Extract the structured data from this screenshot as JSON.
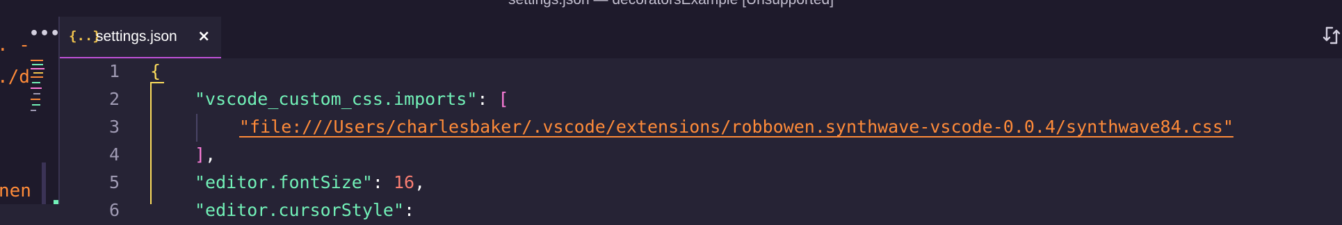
{
  "window": {
    "title": "settings.json — decoratorsExample [Unsupported]"
  },
  "sidebar": {
    "more_label": "•••",
    "fragments": [
      ". -",
      "./d",
      "nen"
    ]
  },
  "tabs": [
    {
      "icon": "{..}",
      "label": "settings.json",
      "close": "×",
      "active": true
    }
  ],
  "editor": {
    "lines": [
      {
        "number": "1",
        "text": "{"
      },
      {
        "number": "2",
        "key": "\"vscode_custom_css.imports\"",
        "sep": ": ",
        "after": "["
      },
      {
        "number": "3",
        "value": "\"file:///Users/charlesbaker/.vscode/extensions/robbowen.synthwave-vscode-0.0.4/synthwave84.css\""
      },
      {
        "number": "4",
        "after": "]",
        "sep": ","
      },
      {
        "number": "5",
        "key": "\"editor.fontSize\"",
        "sep": ": ",
        "value": "16",
        "tail": ","
      },
      {
        "number": "6",
        "key": "\"editor.cursorStyle\"",
        "sep": ": "
      }
    ]
  },
  "colors": {
    "background": "#262335",
    "chrome": "#1e1a2b",
    "accent": "#c051d8",
    "key": "#72f1b8",
    "string": "#ff8b39",
    "number": "#f97e72",
    "brace": "#fede5d",
    "bracket": "#ff7edb"
  },
  "icons": {
    "tab": "json-braces-icon",
    "toolbar": "compare-changes-icon"
  }
}
